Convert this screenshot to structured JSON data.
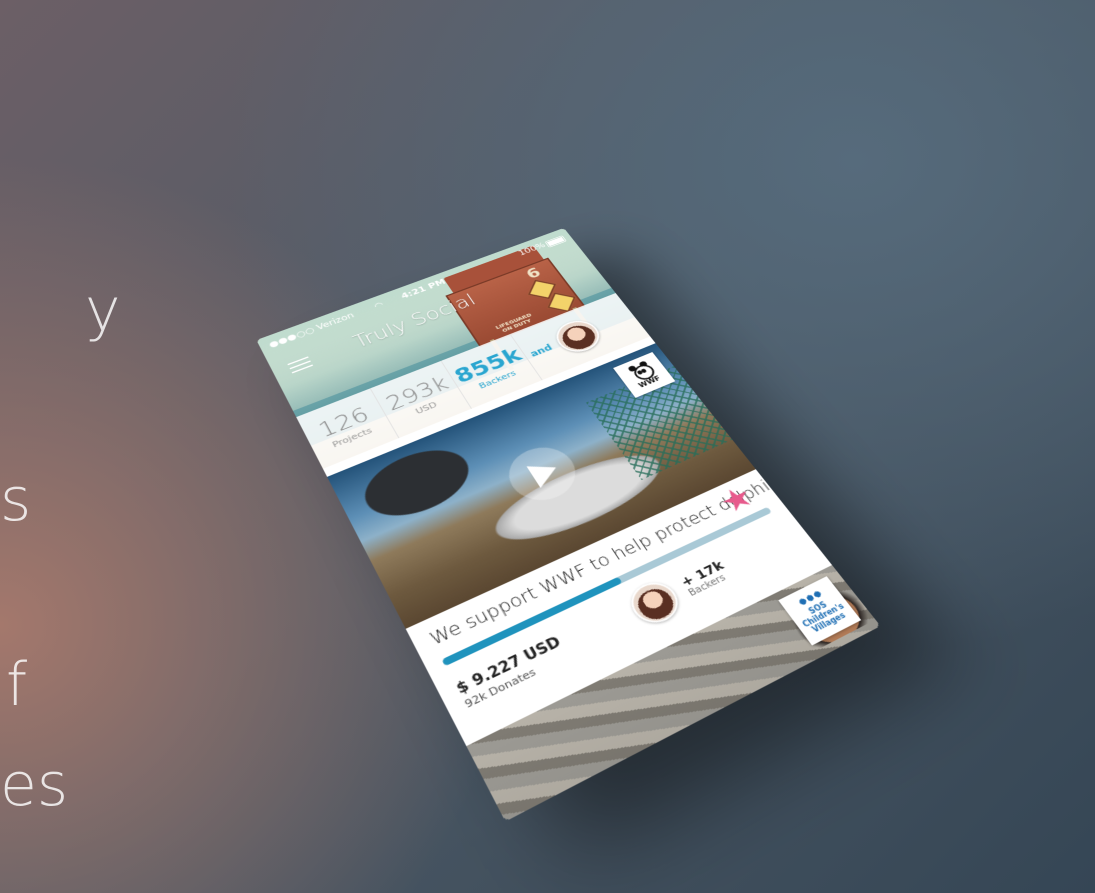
{
  "background_text": {
    "lines": [
      "y",
      "s",
      "f",
      "es"
    ]
  },
  "status_bar": {
    "carrier": "●●●○○ Verizon",
    "time": "4:21 PM",
    "battery": "100%"
  },
  "header": {
    "title": "Truly Social",
    "tower_number": "6",
    "tower_sign": "LIFEGUARD ON DUTY"
  },
  "stats": [
    {
      "value": "126",
      "label": "Projects"
    },
    {
      "value": "293k",
      "label": "USD"
    },
    {
      "value": "855k",
      "label": "Backers"
    }
  ],
  "stats_and": "and",
  "card": {
    "org": "WWF",
    "title": "We support WWF to help protect dolphins",
    "progress": 0.52,
    "amount": "$ 9.227 USD",
    "donates": "92k Donates",
    "backers_count": "+ 17k",
    "backers_label": "Backers"
  },
  "next_card": {
    "org_line1": "SOS",
    "org_line2": "Children's",
    "org_line3": "Villages"
  },
  "colors": {
    "accent": "#2aa6d0",
    "progress": "#1f93bd",
    "favorite": "#e75a8c"
  }
}
